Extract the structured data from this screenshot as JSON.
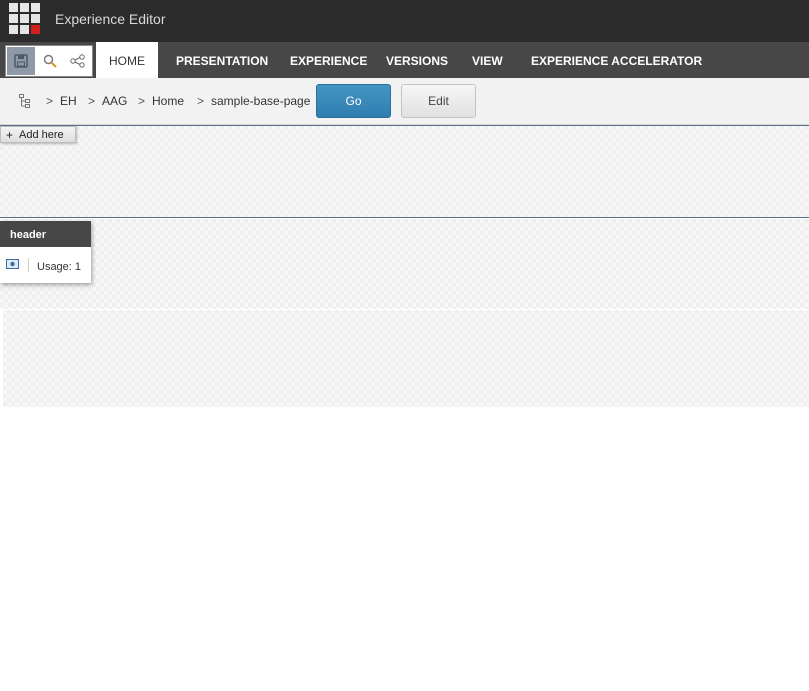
{
  "app": {
    "title": "Experience Editor"
  },
  "ribbon": {
    "tabs": [
      {
        "label": "HOME",
        "active": true
      },
      {
        "label": "PRESENTATION",
        "active": false
      },
      {
        "label": "EXPERIENCE",
        "active": false
      },
      {
        "label": "VERSIONS",
        "active": false
      },
      {
        "label": "VIEW",
        "active": false
      },
      {
        "label": "EXPERIENCE ACCELERATOR",
        "active": false
      }
    ],
    "quick_access": [
      "save-icon",
      "search-icon",
      "navigate-tree-icon"
    ]
  },
  "breadcrumb": {
    "items": [
      "EH",
      "AAG",
      "Home",
      "sample-base-page"
    ],
    "separator": ">",
    "go_label": "Go",
    "edit_label": "Edit"
  },
  "placeholder": {
    "add_label": "Add here"
  },
  "rendering": {
    "name": "header",
    "usage": "Usage: 1"
  },
  "colors": {
    "topbar": "#2b2b2b",
    "ribbon": "#474747",
    "go_button": "#3a88b8",
    "logo_accent": "#d0201b"
  }
}
